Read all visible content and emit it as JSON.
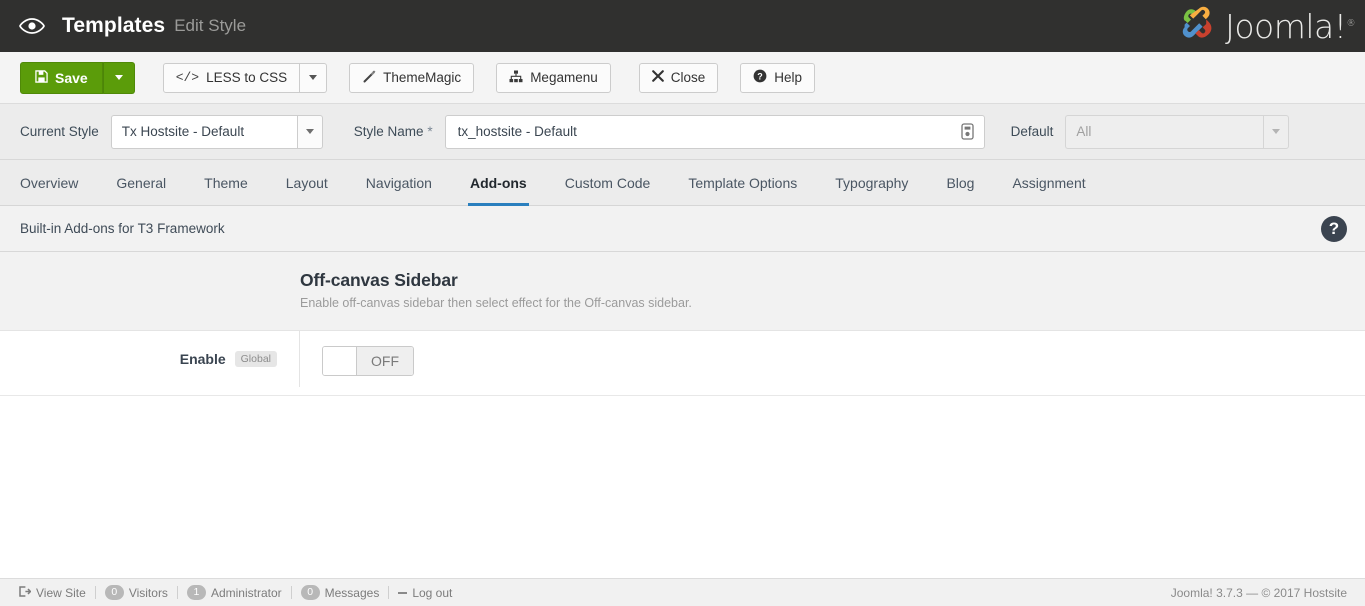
{
  "header": {
    "eye_icon": "eye-icon",
    "title": "Templates",
    "subtitle": "Edit Style",
    "brand": "Joomla!",
    "brand_reg": "®"
  },
  "toolbar": {
    "save_label": "Save",
    "save_icon": "floppy-save-icon",
    "save_caret_icon": "chevron-down-icon",
    "less_to_css_label": "LESS to CSS",
    "less_to_css_icon": "code-brackets-icon",
    "less_caret_icon": "chevron-down-icon",
    "thememagic_label": "ThemeMagic",
    "thememagic_icon": "magic-wand-icon",
    "megamenu_label": "Megamenu",
    "megamenu_icon": "sitemap-icon",
    "close_label": "Close",
    "close_icon": "close-x-icon",
    "help_label": "Help",
    "help_icon": "question-circle-icon"
  },
  "stylebar": {
    "current_style_label": "Current Style",
    "current_style_value": "Tx Hostsite - Default",
    "style_name_label": "Style Name",
    "style_name_required": "*",
    "style_name_value": "tx_hostsite - Default",
    "style_name_addon_icon": "field-insert-icon",
    "default_label": "Default",
    "default_value": "All"
  },
  "tabs": [
    {
      "label": "Overview",
      "active": false
    },
    {
      "label": "General",
      "active": false
    },
    {
      "label": "Theme",
      "active": false
    },
    {
      "label": "Layout",
      "active": false
    },
    {
      "label": "Navigation",
      "active": false
    },
    {
      "label": "Add-ons",
      "active": true
    },
    {
      "label": "Custom Code",
      "active": false
    },
    {
      "label": "Template Options",
      "active": false
    },
    {
      "label": "Typography",
      "active": false
    },
    {
      "label": "Blog",
      "active": false
    },
    {
      "label": "Assignment",
      "active": false
    }
  ],
  "infobar": {
    "text": "Built-in Add-ons for T3 Framework",
    "help_icon": "question-circle-icon",
    "help_glyph": "?"
  },
  "section": {
    "title": "Off-canvas Sidebar",
    "description": "Enable off-canvas sidebar then select effect for the Off-canvas sidebar."
  },
  "field": {
    "label": "Enable",
    "badge": "Global",
    "toggle_on_label": "",
    "toggle_off_label": "OFF",
    "toggle_state": "OFF"
  },
  "footer": {
    "view_site": "View Site",
    "view_site_icon": "external-exit-icon",
    "visitors_count": "0",
    "visitors_label": "Visitors",
    "administrator_count": "1",
    "administrator_label": "Administrator",
    "messages_count": "0",
    "messages_label": "Messages",
    "logout_label": "Log out",
    "logout_icon": "minus-icon",
    "version": "Joomla! 3.7.3  —  © 2017 Hostsite"
  },
  "colors": {
    "header_bg": "#30302f",
    "save_green": "#5b9c0a",
    "tab_active_underline": "#2a7fbe",
    "joomla_green": "#7ac143",
    "joomla_orange": "#f9ae41",
    "joomla_blue": "#5091cd",
    "joomla_red": "#c9412e"
  }
}
